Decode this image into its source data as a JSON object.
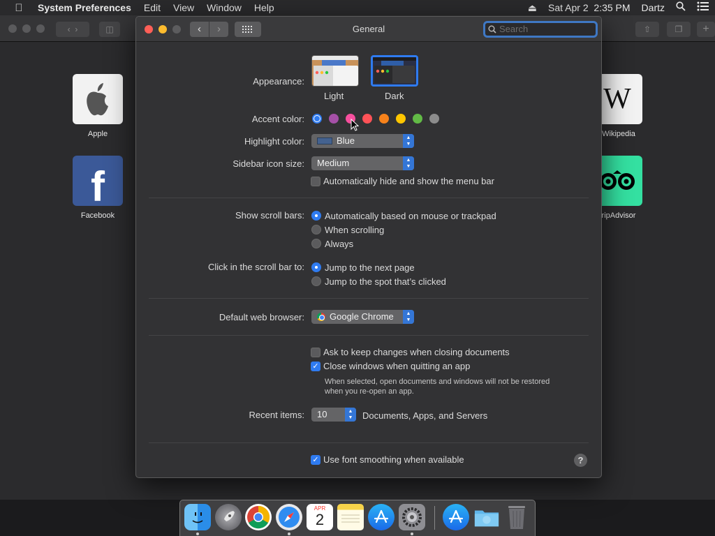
{
  "menubar": {
    "app_name": "System Preferences",
    "items": [
      "Edit",
      "View",
      "Window",
      "Help"
    ],
    "date_time": "Sat Apr 2  2:35 PM",
    "user": "Dartz"
  },
  "favorites": {
    "apple": "Apple",
    "facebook": "Facebook",
    "wikipedia": "Wikipedia",
    "tripadvisor": "ripAdvisor",
    "wikipedia_letter": "W",
    "facebook_letter": "f"
  },
  "window": {
    "title": "General",
    "search_placeholder": "Search"
  },
  "appearance": {
    "label": "Appearance:",
    "options": [
      "Light",
      "Dark"
    ],
    "selected": "Dark"
  },
  "accent": {
    "label": "Accent color:",
    "colors": [
      "#2f7bf0",
      "#a550a7",
      "#f74f9e",
      "#ff5257",
      "#f7821b",
      "#ffc600",
      "#62ba46",
      "#8c8c8c"
    ],
    "selected_index": 0
  },
  "highlight": {
    "label": "Highlight color:",
    "value": "Blue"
  },
  "sidebar": {
    "label": "Sidebar icon size:",
    "value": "Medium"
  },
  "menubar_autohide": {
    "label": "Automatically hide and show the menu bar",
    "checked": false
  },
  "scrollbars": {
    "label": "Show scroll bars:",
    "options": [
      "Automatically based on mouse or trackpad",
      "When scrolling",
      "Always"
    ],
    "selected_index": 0
  },
  "scroll_click": {
    "label": "Click in the scroll bar to:",
    "options": [
      "Jump to the next page",
      "Jump to the spot that’s clicked"
    ],
    "selected_index": 0
  },
  "browser": {
    "label": "Default web browser:",
    "value": "Google Chrome"
  },
  "documents": {
    "ask_keep": "Ask to keep changes when closing documents",
    "ask_keep_checked": false,
    "close_windows": "Close windows when quitting an app",
    "close_windows_checked": true,
    "note_line1": "When selected, open documents and windows will not be restored",
    "note_line2": "when you re-open an app."
  },
  "recent": {
    "label": "Recent items:",
    "value": "10",
    "suffix": "Documents, Apps, and Servers"
  },
  "font_smoothing": {
    "label": "Use font smoothing when available",
    "checked": true
  },
  "help": "?",
  "dock": {
    "calendar_month": "APR",
    "calendar_day": "2"
  }
}
